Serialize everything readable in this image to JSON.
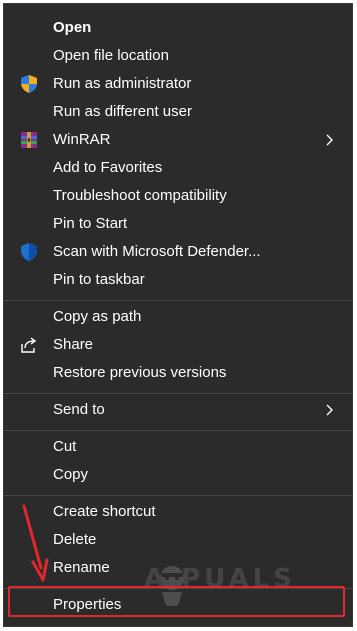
{
  "menu": {
    "items": [
      {
        "label": "Open",
        "icon": "",
        "bold": true
      },
      {
        "label": "Open file location",
        "icon": ""
      },
      {
        "label": "Run as administrator",
        "icon": "uac-shield-icon"
      },
      {
        "label": "Run as different user",
        "icon": ""
      },
      {
        "label": "WinRAR",
        "icon": "winrar-icon",
        "submenu": true
      },
      {
        "label": "Add to Favorites",
        "icon": ""
      },
      {
        "label": "Troubleshoot compatibility",
        "icon": ""
      },
      {
        "label": "Pin to Start",
        "icon": ""
      },
      {
        "label": "Scan with Microsoft Defender...",
        "icon": "defender-shield-icon"
      },
      {
        "label": "Pin to taskbar",
        "icon": ""
      },
      {
        "label": "Copy as path",
        "icon": ""
      },
      {
        "label": "Share",
        "icon": "share-icon"
      },
      {
        "label": "Restore previous versions",
        "icon": ""
      },
      {
        "label": "Send to",
        "icon": "",
        "submenu": true
      },
      {
        "label": "Cut",
        "icon": ""
      },
      {
        "label": "Copy",
        "icon": ""
      },
      {
        "label": "Create shortcut",
        "icon": ""
      },
      {
        "label": "Delete",
        "icon": ""
      },
      {
        "label": "Rename",
        "icon": ""
      },
      {
        "label": "Properties",
        "icon": "",
        "highlighted": true
      }
    ]
  },
  "annotation": {
    "highlight_color": "#e0282e",
    "arrow_color": "#e0282e",
    "highlighted_item": "Properties"
  },
  "watermark": {
    "text": "A PUALS"
  },
  "colors": {
    "menu_background": "#2b2b2b",
    "text": "#ffffff",
    "separator": "#474747"
  }
}
